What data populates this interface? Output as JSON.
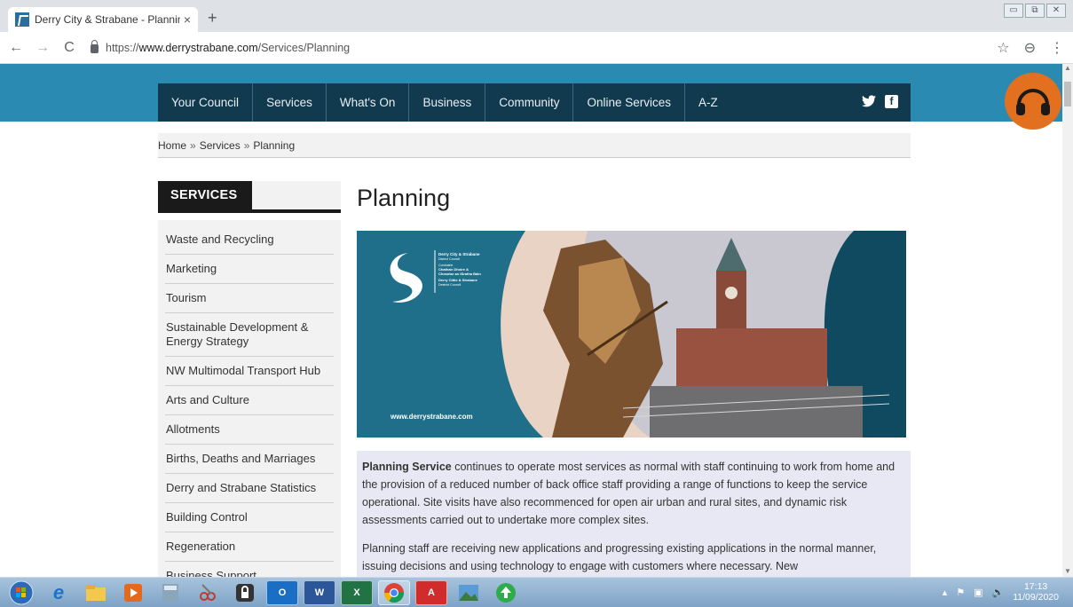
{
  "browser": {
    "tab_title": "Derry City & Strabane - Planning",
    "tab_close": "×",
    "new_tab": "+",
    "url_prefix": "https://",
    "url_host": "www.derrystrabane.com",
    "url_path": "/Services/Planning",
    "back": "←",
    "forward": "→",
    "reload": "C",
    "star": "☆",
    "profile": "⊖",
    "menu": "⋮"
  },
  "window_controls": {
    "minimize": "▭",
    "restore": "⧉",
    "close": "✕"
  },
  "nav": {
    "items": [
      "Your Council",
      "Services",
      "What's On",
      "Business",
      "Community",
      "Online Services",
      "A-Z"
    ],
    "twitter": "🐦",
    "facebook": "f"
  },
  "breadcrumb": {
    "home": "Home",
    "sep": "»",
    "services": "Services",
    "current": "Planning"
  },
  "sidebar": {
    "heading": "SERVICES",
    "items": [
      "Waste and Recycling",
      "Marketing",
      "Tourism",
      "Sustainable Development & Energy Strategy",
      "NW Multimodal Transport Hub",
      "Arts and Culture",
      "Allotments",
      "Births, Deaths and Marriages",
      "Derry and Strabane Statistics",
      "Building Control",
      "Regeneration",
      "Business Support"
    ]
  },
  "content": {
    "title": "Planning",
    "banner": {
      "brand_line1": "Derry City & Strabane",
      "brand_line2": "District Council",
      "brand_line3": "Comhairle",
      "brand_line4": "Chathair Dhoire &",
      "brand_line5": "Cheantar an tSratha Báin",
      "brand_line6": "Derry Cittie & Strabane",
      "brand_line7": "Destrict Cooncil",
      "website": "www.derrystrabane.com"
    },
    "para1_bold": "Planning Service",
    "para1_rest": " continues to operate most services as normal with staff continuing to work from home and the provision of a reduced number of back office staff providing a range of functions to keep the service operational. Site visits have also recommenced for open air urban and rural sites, and dynamic risk assessments carried out to undertake more complex sites.",
    "para2": "Planning staff are receiving new applications and progressing existing applications in the normal manner, issuing decisions and using technology to engage with customers where necessary.  New"
  },
  "taskbar": {
    "time": "17:13",
    "date": "11/09/2020"
  },
  "colors": {
    "hero_blue": "#2a8ab2",
    "nav_dark": "#123a4f",
    "accent_orange": "#e3701e",
    "info_bg": "#e8e8f4"
  }
}
